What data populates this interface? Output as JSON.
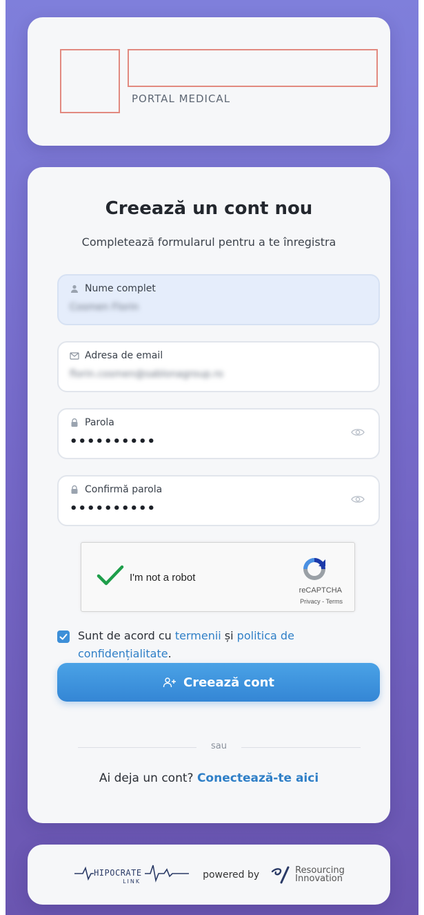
{
  "header": {
    "subtitle": "PORTAL MEDICAL"
  },
  "form": {
    "title": "Creează un cont nou",
    "subtitle": "Completează formularul pentru a te înregistra",
    "fields": [
      {
        "label": "Nume complet",
        "value": "Cosmen Florin",
        "icon": "user-icon"
      },
      {
        "label": "Adresa de email",
        "value": "florin.cosmen@sablonagroup.ro",
        "icon": "mail-icon"
      },
      {
        "label": "Parola",
        "value": "••••••••••",
        "icon": "lock-icon"
      },
      {
        "label": "Confirmă parola",
        "value": "••••••••••",
        "icon": "lock-icon"
      }
    ],
    "captcha": {
      "text": "I'm not a robot",
      "brand": "reCAPTCHA",
      "links": "Privacy - Terms",
      "checked": true
    },
    "agree": {
      "prefix": "Sunt de acord cu ",
      "terms": "termenii",
      "mid": " și ",
      "privacy": "politica de confidențialitate",
      "suffix": ".",
      "checked": true
    },
    "submit_label": "Creează cont",
    "divider_text": "sau",
    "login_prompt": "Ai deja un cont? ",
    "login_link": "Conectează-te aici"
  },
  "footer": {
    "hipocrate": "HIPOCRATE",
    "hipocrate_sub": "LINK",
    "powered_by": "powered by",
    "partner_line1": "Resourcing",
    "partner_line2": "Innovation"
  },
  "colors": {
    "accent": "#3486d5",
    "link": "#2f7fc7",
    "logo_placeholder": "#e28a80"
  }
}
